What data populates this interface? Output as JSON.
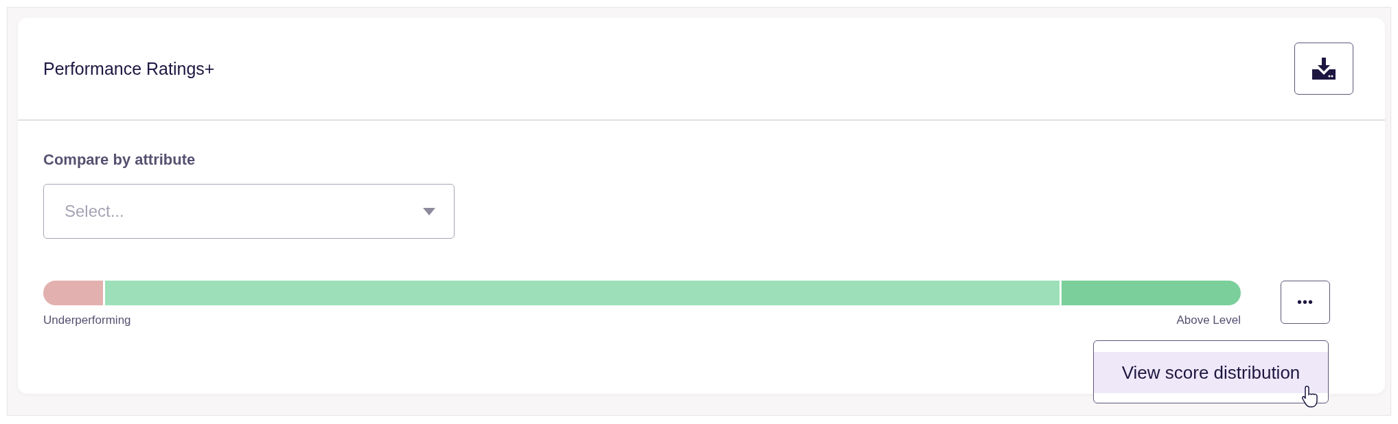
{
  "card": {
    "title": "Performance Ratings+",
    "download_button": {
      "kind": "download"
    }
  },
  "filter": {
    "label": "Compare by attribute",
    "placeholder": "Select..."
  },
  "rating_bar": {
    "segments": [
      {
        "color": "#e2b0ae"
      },
      {
        "color": "#9ddfb8"
      },
      {
        "color": "#7acf9a"
      }
    ],
    "start_label": "Underperforming",
    "end_label": "Above Level"
  },
  "more_button": {
    "label": "•••"
  },
  "menu": {
    "items": [
      {
        "label": "View score distribution",
        "selected": true
      }
    ]
  }
}
